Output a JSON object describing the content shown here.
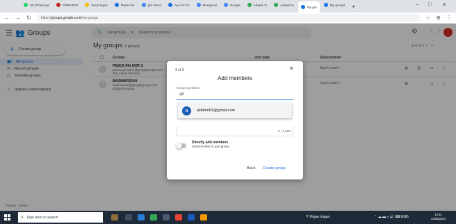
{
  "browser": {
    "tabs": [
      {
        "label": "(2) WhatsApp",
        "color": "#25d366"
      },
      {
        "label": "GWM BKS",
        "color": "#c5221f"
      },
      {
        "label": "Surat tugas",
        "color": "#fbbc04"
      },
      {
        "label": "Dasar ker",
        "color": "#1a73e8"
      },
      {
        "label": "gtk Verva",
        "color": "#4285f4"
      },
      {
        "label": "Ayo Ke Pe",
        "color": "#1a73e8"
      },
      {
        "label": "Mengenal",
        "color": "#4285f4"
      },
      {
        "label": "Google",
        "color": "#4285f4"
      },
      {
        "label": "Adapte In",
        "color": "#34a853"
      },
      {
        "label": "Adapte In",
        "color": "#34a853"
      },
      {
        "label": "My gro",
        "color": "#1a73e8"
      },
      {
        "label": "My groups",
        "color": "#1a73e8"
      }
    ],
    "url_prefix": "https://",
    "url_host": "groups.google.com",
    "url_path": "/my-groups"
  },
  "app": {
    "name": "Groups",
    "search_scope": "My groups",
    "search_placeholder": "Search my groups"
  },
  "sidebar": {
    "create_label": "Create group",
    "items": [
      {
        "label": "My groups",
        "active": true
      },
      {
        "label": "Recent groups"
      },
      {
        "label": "Favorite groups"
      },
      {
        "label": "Starred conversations"
      }
    ],
    "footer": "Privacy · Terms"
  },
  "main": {
    "title": "My groups",
    "count": "2 groups",
    "pager": "1–2 of 2",
    "headers": {
      "groups": "Groups",
      "join_date": "Join date",
      "subscription": "Subscription"
    },
    "rows": [
      {
        "name": "PASCA PAI UNIT 2",
        "email": "pasca-pai-unit-2@googlegroups.com",
        "extra": "DOLANAN INOVASI",
        "subscription": "Each email"
      },
      {
        "name": "BAIDMARZUKI",
        "email": "baidmarzuki@googlegroups.com",
        "extra": "belajar bersama",
        "subscription": "Each email"
      }
    ]
  },
  "dialog": {
    "step": "3 of 3",
    "title": "Add members",
    "field_label": "Group members",
    "input_value": "ali",
    "suggestion": {
      "initial": "a",
      "email": "alibibm81@gmail.com"
    },
    "counter": "0 / 1,000",
    "toggle_title": "Directly add members",
    "toggle_sub": "Send invites to join group",
    "back_label": "Back",
    "create_label": "Create group"
  },
  "taskbar": {
    "search_placeholder": "Type here to search",
    "weather": "Hujan ringan",
    "lang": "ENG",
    "time": "12:01",
    "date": "20/05/2024"
  }
}
